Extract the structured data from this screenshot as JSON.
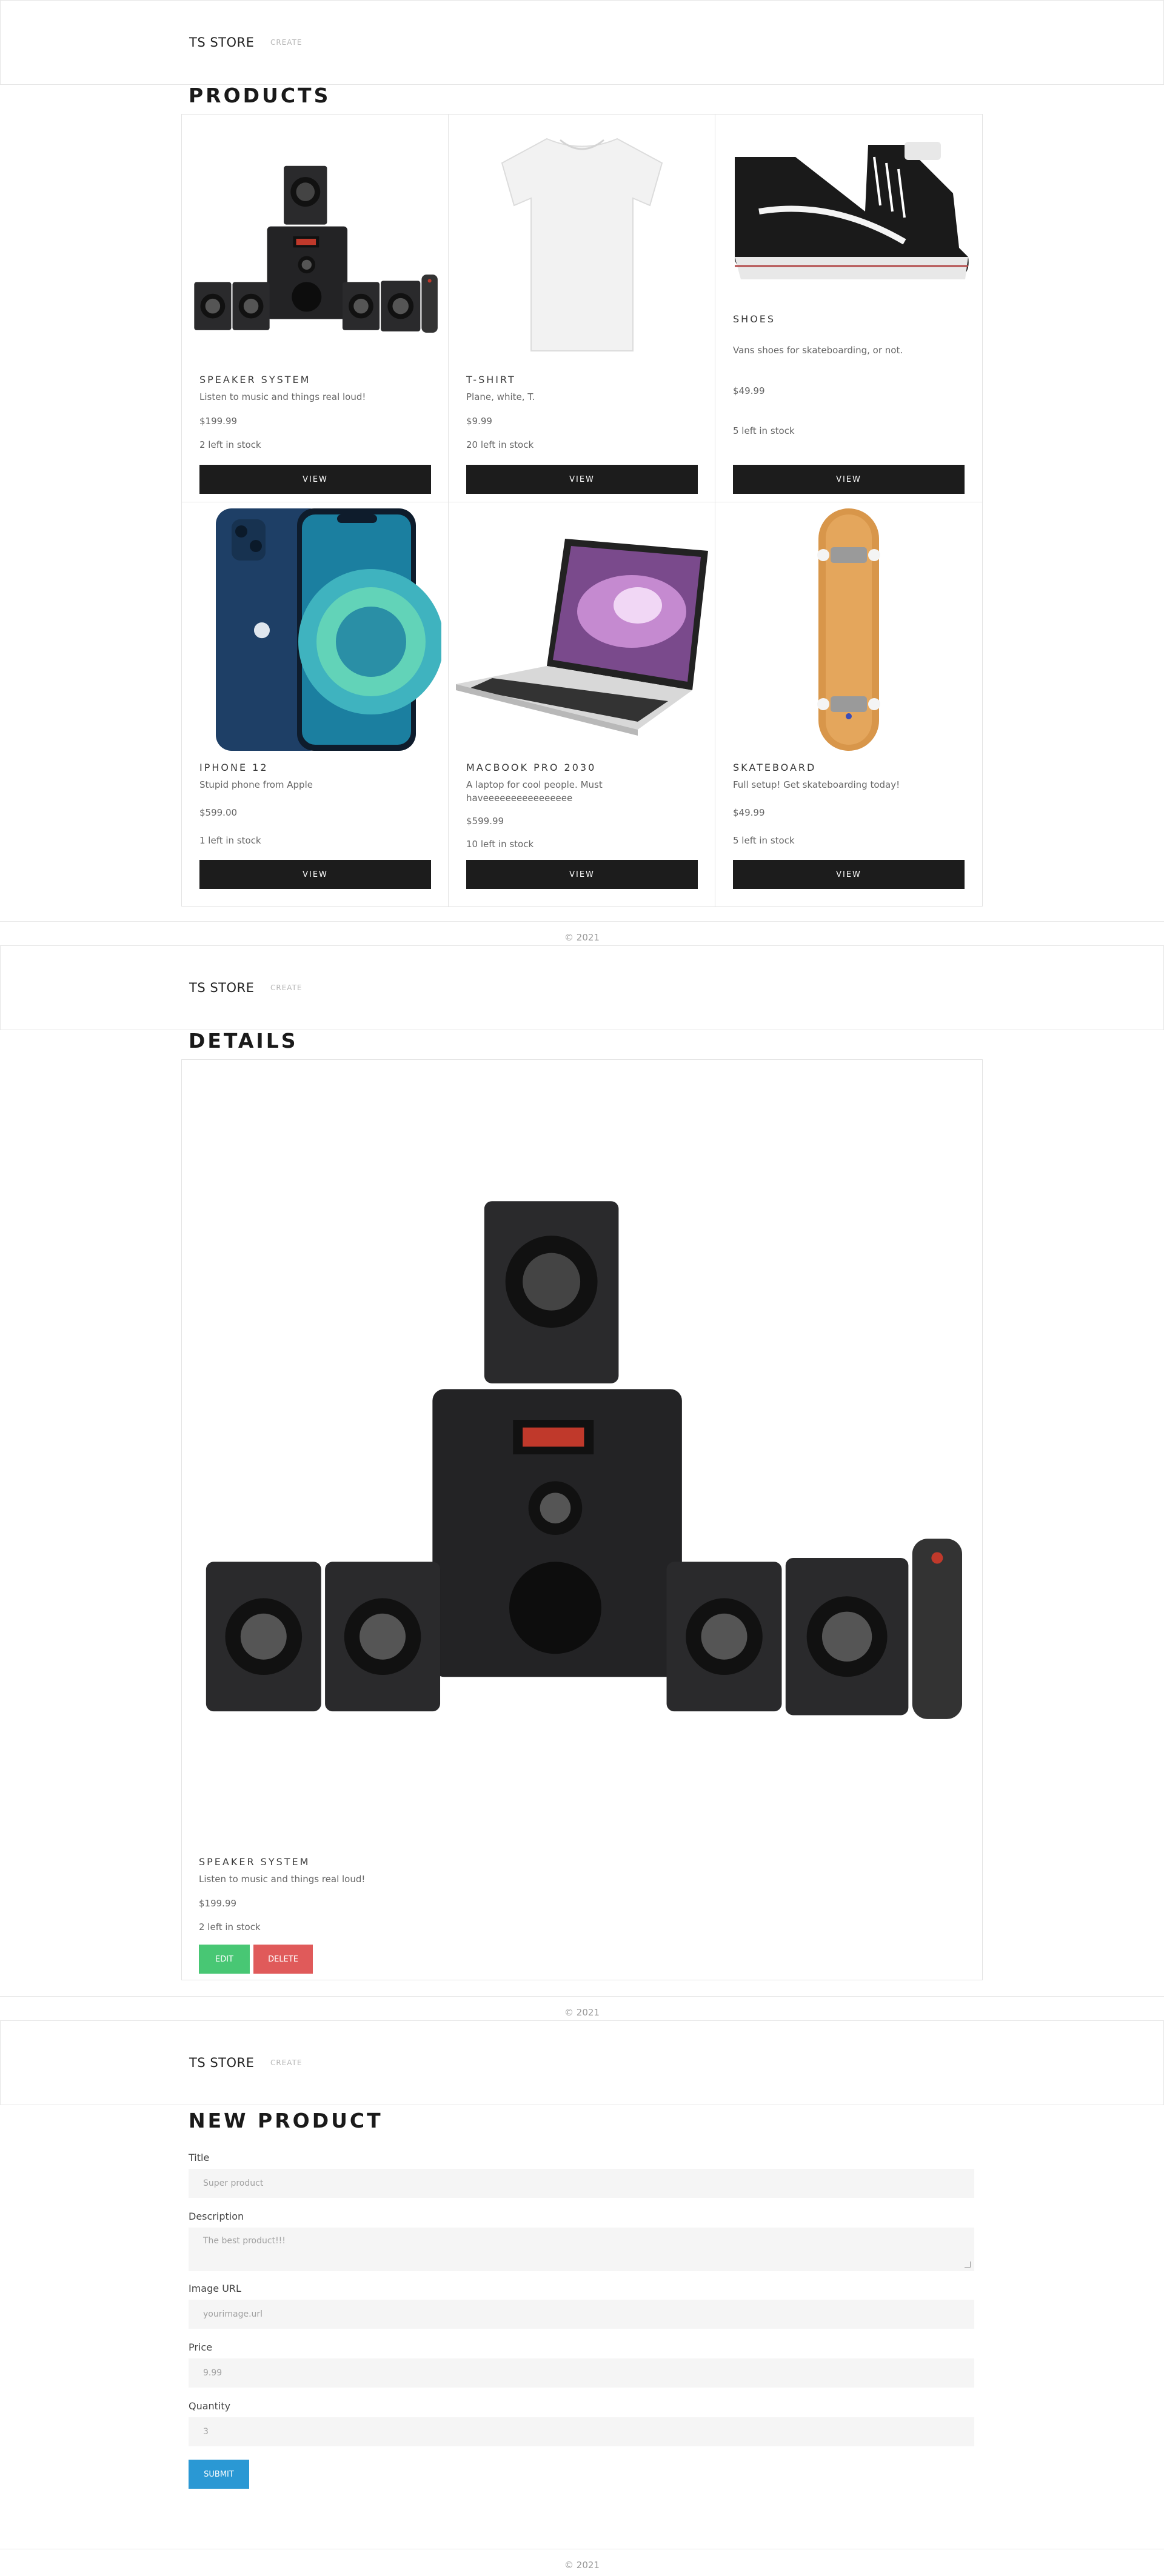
{
  "nav": {
    "brand": "TS STORE",
    "create_link": "CREATE"
  },
  "footer": {
    "text": "© 2021"
  },
  "products_page": {
    "title": "PRODUCTS",
    "view_label": "VIEW",
    "products": [
      {
        "title": "SPEAKER SYSTEM",
        "description": "Listen to music and things real loud!",
        "price": "$199.99",
        "stock": "2 left in stock",
        "image": "speaker-system-image"
      },
      {
        "title": "T-SHIRT",
        "description": "Plane, white, T.",
        "price": "$9.99",
        "stock": "20 left in stock",
        "image": "tshirt-image"
      },
      {
        "title": "SHOES",
        "description": "Vans shoes for skateboarding, or not.",
        "price": "$49.99",
        "stock": "5 left in stock",
        "image": "shoes-image"
      },
      {
        "title": "IPHONE 12",
        "description": "Stupid phone from Apple",
        "price": "$599.00",
        "stock": "1 left in stock",
        "image": "iphone-image"
      },
      {
        "title": "MACBOOK PRO 2030",
        "description": "A laptop for cool people. Must haveeeeeeeeeeeeeeee",
        "price": "$599.99",
        "stock": "10 left in stock",
        "image": "macbook-image"
      },
      {
        "title": "SKATEBOARD",
        "description": "Full setup! Get skateboarding today!",
        "price": "$49.99",
        "stock": "5 left in stock",
        "image": "skateboard-image"
      }
    ]
  },
  "details_page": {
    "title": "DETAILS",
    "product": {
      "title": "SPEAKER SYSTEM",
      "description": "Listen to music and things real loud!",
      "price": "$199.99",
      "stock": "2 left in stock"
    },
    "edit_label": "EDIT",
    "delete_label": "DELETE"
  },
  "new_product_page": {
    "title": "NEW PRODUCT",
    "fields": {
      "title": {
        "label": "Title",
        "placeholder": "Super product"
      },
      "description": {
        "label": "Description",
        "placeholder": "The best product!!!"
      },
      "image_url": {
        "label": "Image URL",
        "placeholder": "yourimage.url"
      },
      "price": {
        "label": "Price",
        "placeholder": "9.99"
      },
      "quantity": {
        "label": "Quantity",
        "placeholder": "3"
      }
    },
    "submit_label": "SUBMIT"
  },
  "colors": {
    "dark_button": "#1c1c1c",
    "edit": "#48c774",
    "delete": "#e05a5a",
    "submit": "#2a98d4"
  }
}
